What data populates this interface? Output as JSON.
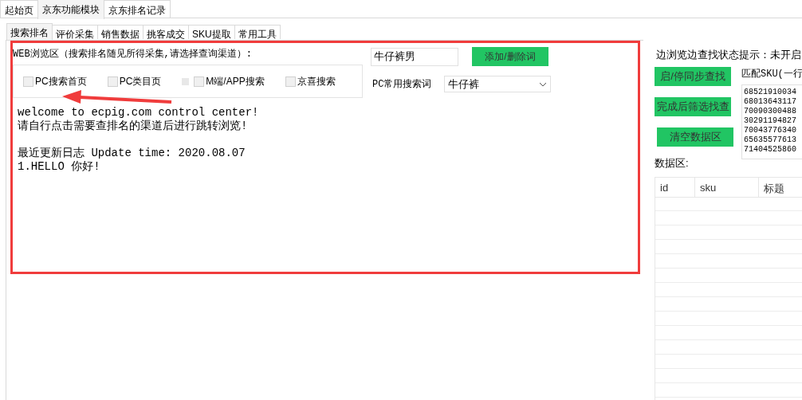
{
  "main_tabs": [
    {
      "label": "起始页",
      "selected": false
    },
    {
      "label": "京东功能模块",
      "selected": true
    },
    {
      "label": "京东排名记录",
      "selected": false
    }
  ],
  "sub_tabs": [
    {
      "label": "搜索排名",
      "selected": true
    },
    {
      "label": "评价采集",
      "selected": false
    },
    {
      "label": "销售数据",
      "selected": false
    },
    {
      "label": "挑客成交",
      "selected": false
    },
    {
      "label": "SKU提取",
      "selected": false
    },
    {
      "label": "常用工具",
      "selected": false
    }
  ],
  "browser_panel": {
    "title": "WEB浏览区（搜索排名随见所得采集,请选择查询渠道）:",
    "channels": [
      {
        "label": "PC搜索首页",
        "checked": false
      },
      {
        "label": "PC类目页",
        "checked": false
      },
      {
        "label": "M端/APP搜索",
        "checked": false
      },
      {
        "label": "京喜搜索",
        "checked": false
      }
    ],
    "keyword_field": {
      "value": "牛仔裤男"
    },
    "add_button": "添加/删除词",
    "common_label": "PC常用搜索词",
    "common_select": {
      "value": "牛仔裤"
    },
    "log": [
      [
        "welcome to ecpig.com control center!",
        "请自行点击需要查排名的渠道后进行跳转浏览!"
      ],
      [
        "最近更新日志 Update time: 2020.08.07",
        "1.HELLO 你好!"
      ]
    ]
  },
  "right_panel": {
    "status": "边浏览边查找状态提示：未开启",
    "buttons": [
      "启/停同步查找",
      "完成后筛选找查",
      "清空数据区"
    ],
    "sku_label": "匹配SKU(一行",
    "sku_lines": [
      "68521910034",
      "68013643117",
      "70090300488",
      "30291194827",
      "70043776340",
      "65635577613",
      "71404525860"
    ],
    "data_label": "数据区:",
    "table": {
      "columns": [
        "id",
        "sku",
        "标题"
      ]
    }
  }
}
